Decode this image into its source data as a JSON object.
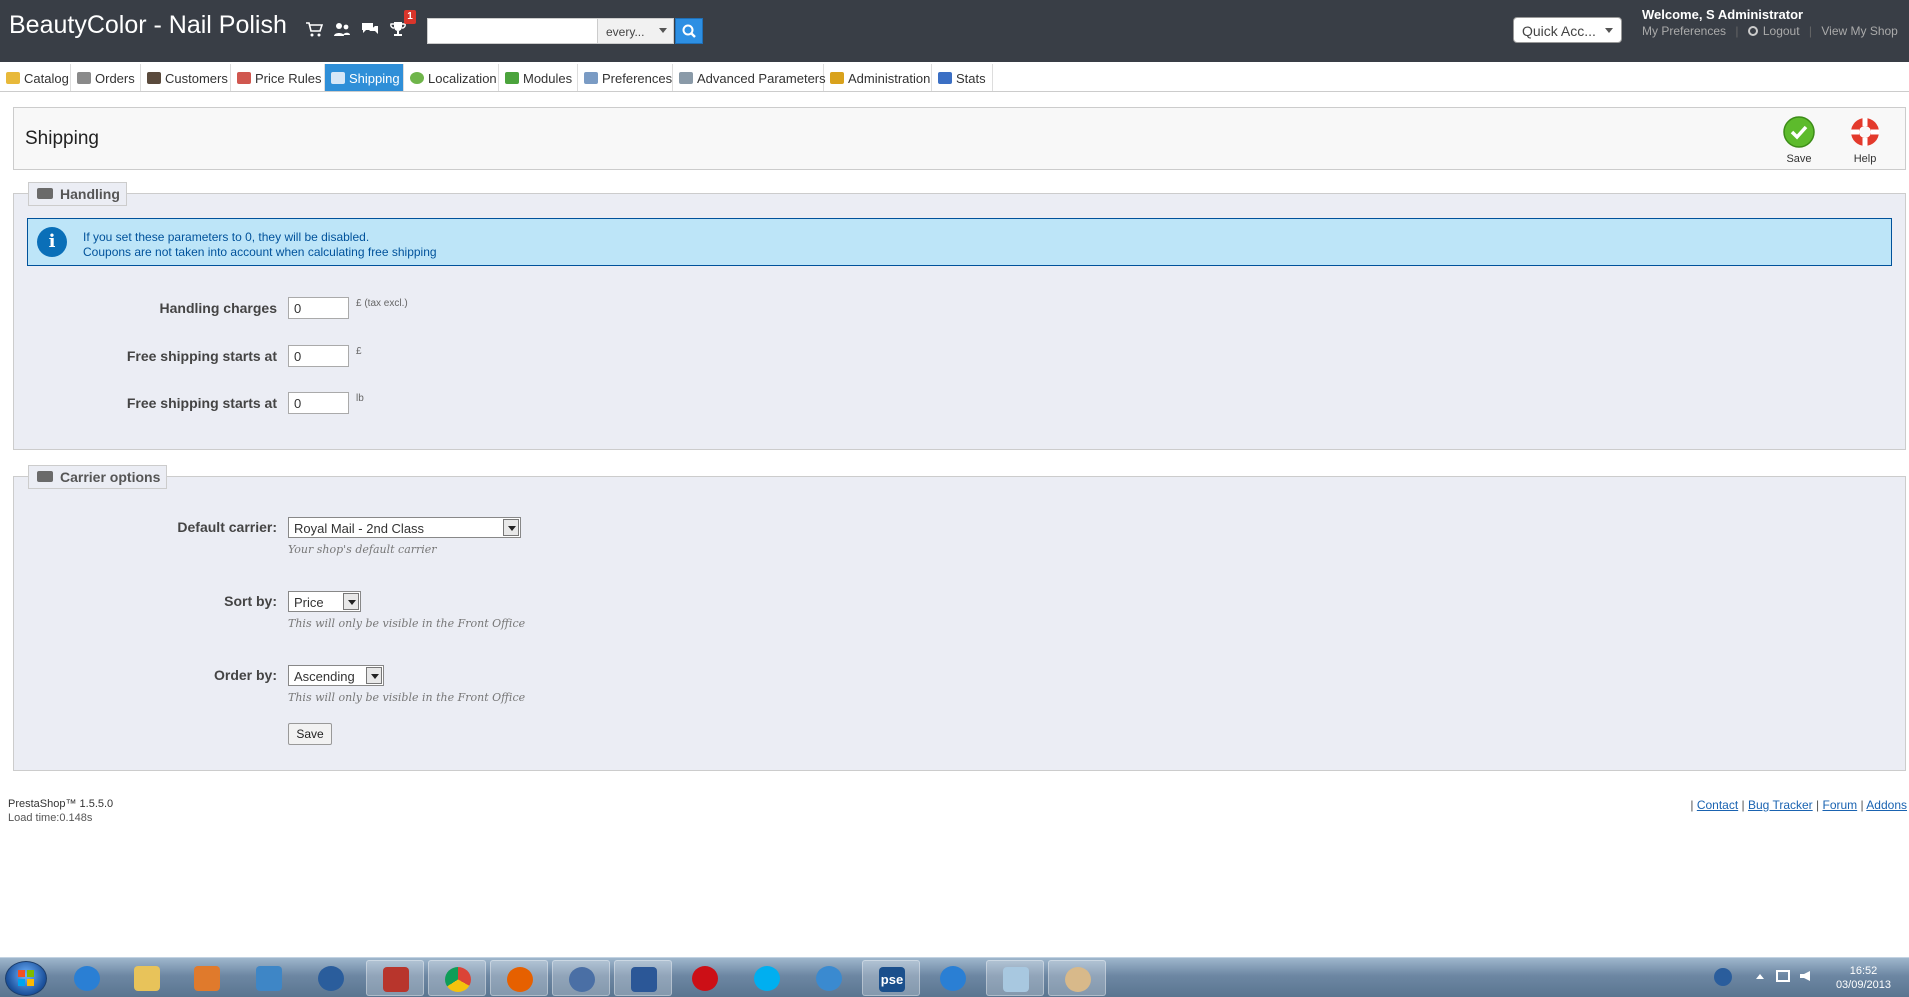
{
  "header": {
    "shop_name": "BeautyColor - Nail Polish",
    "notification_count": "1",
    "search_placeholder": "",
    "search_scope": "every...",
    "quick_access": "Quick Acc...",
    "welcome": "Welcome, S Administrator",
    "links": {
      "preferences": "My Preferences",
      "logout": "Logout",
      "view_shop": "View My Shop"
    }
  },
  "tabs": [
    {
      "label": "Catalog",
      "icon": "folder-icon"
    },
    {
      "label": "Orders",
      "icon": "cart-icon"
    },
    {
      "label": "Customers",
      "icon": "user-icon"
    },
    {
      "label": "Price Rules",
      "icon": "price-tag-icon"
    },
    {
      "label": "Shipping",
      "icon": "truck-icon",
      "active": true
    },
    {
      "label": "Localization",
      "icon": "globe-icon"
    },
    {
      "label": "Modules",
      "icon": "puzzle-icon"
    },
    {
      "label": "Preferences",
      "icon": "window-icon"
    },
    {
      "label": "Advanced Parameters",
      "icon": "wrench-icon"
    },
    {
      "label": "Administration",
      "icon": "key-icon"
    },
    {
      "label": "Stats",
      "icon": "bar-chart-icon"
    }
  ],
  "toolbar": {
    "title": "Shipping",
    "save_label": "Save",
    "help_label": "Help"
  },
  "handling": {
    "legend": "Handling",
    "info_line1": "If you set these parameters to 0, they will be disabled.",
    "info_line2": "Coupons are not taken into account when calculating free shipping",
    "fields": [
      {
        "label": "Handling charges",
        "value": "0",
        "unit": "£ (tax excl.)"
      },
      {
        "label": "Free shipping starts at",
        "value": "0",
        "unit": "£"
      },
      {
        "label": "Free shipping starts at",
        "value": "0",
        "unit": "lb"
      }
    ]
  },
  "carrier": {
    "legend": "Carrier options",
    "default_carrier": {
      "label": "Default carrier:",
      "value": "Royal Mail - 2nd Class",
      "hint": "Your shop's default carrier"
    },
    "sort_by": {
      "label": "Sort by:",
      "value": "Price",
      "hint": "This will only be visible in the Front Office"
    },
    "order_by": {
      "label": "Order by:",
      "value": "Ascending",
      "hint": "This will only be visible in the Front Office"
    },
    "save_label": "Save"
  },
  "footer": {
    "version": "PrestaShop™ 1.5.5.0",
    "load_time": "Load time:0.148s",
    "links": [
      "Contact",
      "Bug Tracker",
      "Forum",
      "Addons"
    ]
  },
  "taskbar": {
    "time": "16:52",
    "date": "03/09/2013",
    "apps": [
      "internet-explorer-icon",
      "file-explorer-icon",
      "media-player-icon",
      "remote-desktop-icon",
      "hp-icon",
      "filezilla-icon",
      "chrome-icon",
      "firefox-icon",
      "thunderbird-icon",
      "word-icon",
      "opera-icon",
      "skype-icon",
      "messenger-icon",
      "photoshop-elements-icon",
      "internet-explorer-icon",
      "notepad-icon",
      "paint-icon"
    ],
    "app_label_pse": "pse"
  },
  "colors": {
    "header_bg": "#393e46",
    "active_tab": "#2f8fd8",
    "fieldset_bg": "#ebedf4",
    "info_bg": "#bde5f8",
    "link": "#1a63b1"
  }
}
